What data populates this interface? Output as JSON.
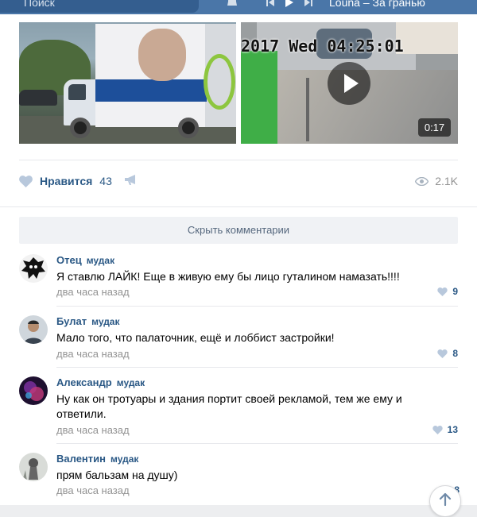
{
  "header": {
    "search_placeholder": "Поиск",
    "now_playing": "Louna – За гранью"
  },
  "post": {
    "video": {
      "timestamp": "2017 Wed 04:25:01",
      "duration": "0:17"
    },
    "likes": {
      "label": "Нравится",
      "count": "43"
    },
    "views": "2.1K"
  },
  "hide_comments_label": "Скрыть комментарии",
  "comments": [
    {
      "author": "Отец",
      "tag": "мудак",
      "text": "Я ставлю ЛАЙК! Еще в живую ему бы лицо гуталином намазать!!!!",
      "time": "два часа назад",
      "likes": "9"
    },
    {
      "author": "Булат",
      "tag": "мудак",
      "text": "Мало того, что палаточник, ещё и лоббист застройки!",
      "time": "два часа назад",
      "likes": "8"
    },
    {
      "author": "Александр",
      "tag": "мудак",
      "text": "Ну как он тротуары и здания портит своей рекламой, тем же ему и ответили.",
      "time": "два часа назад",
      "likes": "13"
    },
    {
      "author": "Валентин",
      "tag": "мудак",
      "text": "прям бальзам на душу)",
      "time": "два часа назад",
      "likes": "8"
    }
  ],
  "colors": {
    "header": "#4a76a8",
    "link": "#2a5885",
    "muted": "#939393",
    "background": "#edeef0"
  }
}
